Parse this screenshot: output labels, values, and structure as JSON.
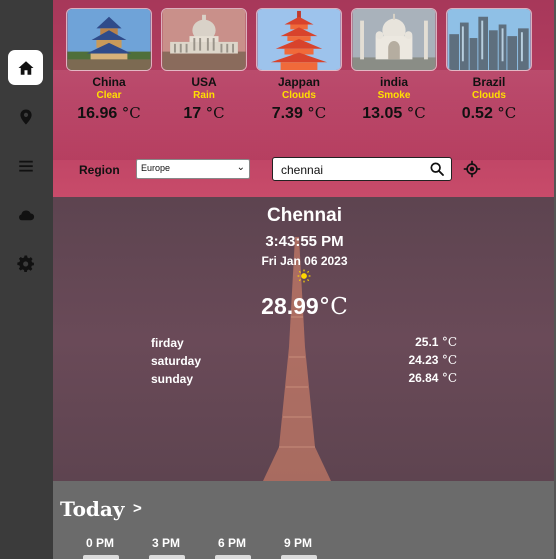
{
  "sidebar": {
    "items": [
      {
        "name": "home",
        "icon": "home-icon"
      },
      {
        "name": "location",
        "icon": "location-pin-icon"
      },
      {
        "name": "menu",
        "icon": "menu-icon"
      },
      {
        "name": "cloud",
        "icon": "cloud-icon"
      },
      {
        "name": "settings",
        "icon": "gear-icon"
      }
    ]
  },
  "cities": [
    {
      "name": "China",
      "condition": "Clear",
      "temp": "16.96",
      "unit": "°C"
    },
    {
      "name": "USA",
      "condition": "Rain",
      "temp": "17",
      "unit": "°C"
    },
    {
      "name": "Jappan",
      "condition": "Clouds",
      "temp": "7.39",
      "unit": "°C"
    },
    {
      "name": "india",
      "condition": "Smoke",
      "temp": "13.05",
      "unit": "°C"
    },
    {
      "name": "Brazil",
      "condition": "Clouds",
      "temp": "0.52",
      "unit": "°C"
    }
  ],
  "controls": {
    "region_label": "Region",
    "region_value": "Europe",
    "search_value": "chennai"
  },
  "current": {
    "city": "Chennai",
    "time": "3:43:55 PM",
    "date": "Fri Jan 06 2023",
    "temp": "28.99",
    "unit": "°C"
  },
  "forecast": [
    {
      "day": "firday",
      "temp": "25.1",
      "unit": "°C"
    },
    {
      "day": "saturday",
      "temp": "24.23",
      "unit": "°C"
    },
    {
      "day": "sunday",
      "temp": "26.84",
      "unit": "°C"
    }
  ],
  "today": {
    "title": "Today",
    "arrow": ">",
    "hours": [
      "0 PM",
      "3 PM",
      "6 PM",
      "9 PM"
    ]
  },
  "colors": {
    "accent_yellow": "#ffe000",
    "top_band": "#b43d60",
    "main_bg": "#634652",
    "today_bg": "#6b6b6b",
    "sidebar_bg": "#3b3b3b"
  }
}
